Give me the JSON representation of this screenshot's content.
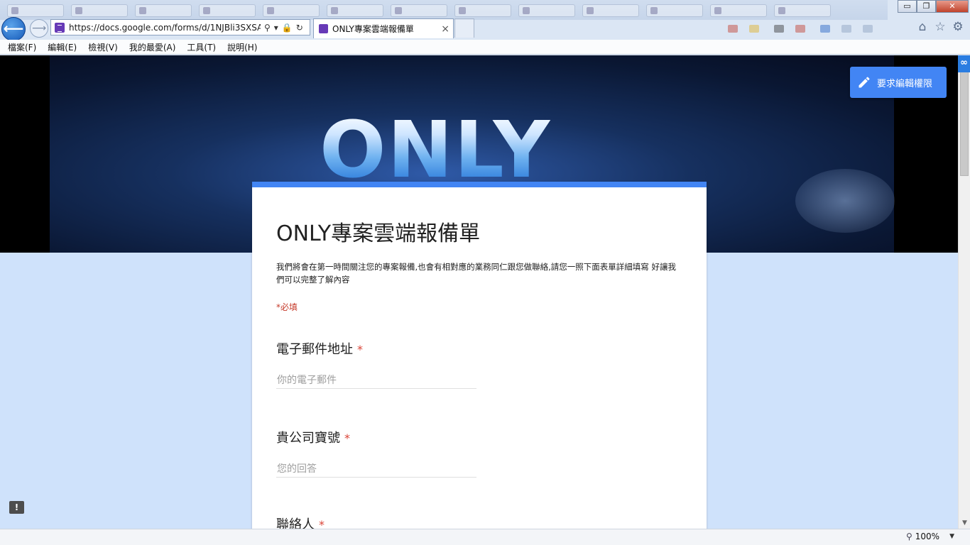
{
  "browser": {
    "address_url": "https://docs.google.com/forms/d/1NJBli3SXSA",
    "active_tab_title": "ONLY專案雲端報備單",
    "menu": [
      "檔案(F)",
      "編輯(E)",
      "檢視(V)",
      "我的最愛(A)",
      "工具(T)",
      "說明(H)"
    ],
    "zoom_level": "100%",
    "window_buttons": {
      "minimize": "▭",
      "restore": "❐",
      "close": "✕"
    },
    "icons": [
      "back-arrow-icon",
      "forward-arrow-icon",
      "search-icon",
      "lock-icon",
      "refresh-icon",
      "home-icon",
      "star-icon",
      "gear-icon",
      "zoom-icon"
    ],
    "accent_color": "#1f5fc4"
  },
  "page": {
    "banner_logo_text": "ONLY",
    "request_edit_label": "要求編輯權限",
    "form_title": "ONLY專案雲端報備單",
    "form_description": "我們將會在第一時間關注您的專案報備,也會有相對應的業務同仁跟您做聯絡,請您一照下面表單詳細填寫 好讓我們可以完整了解內容",
    "required_note": "*必填",
    "questions": [
      {
        "label": "電子郵件地址",
        "required_mark": "*",
        "placeholder": "你的電子郵件"
      },
      {
        "label": "貴公司寶號",
        "required_mark": "*",
        "placeholder": "您的回答"
      },
      {
        "label": "聯絡人",
        "required_mark": "*",
        "placeholder": ""
      }
    ],
    "theme_color": "#4285f4",
    "background_color": "#cfe2fb"
  }
}
